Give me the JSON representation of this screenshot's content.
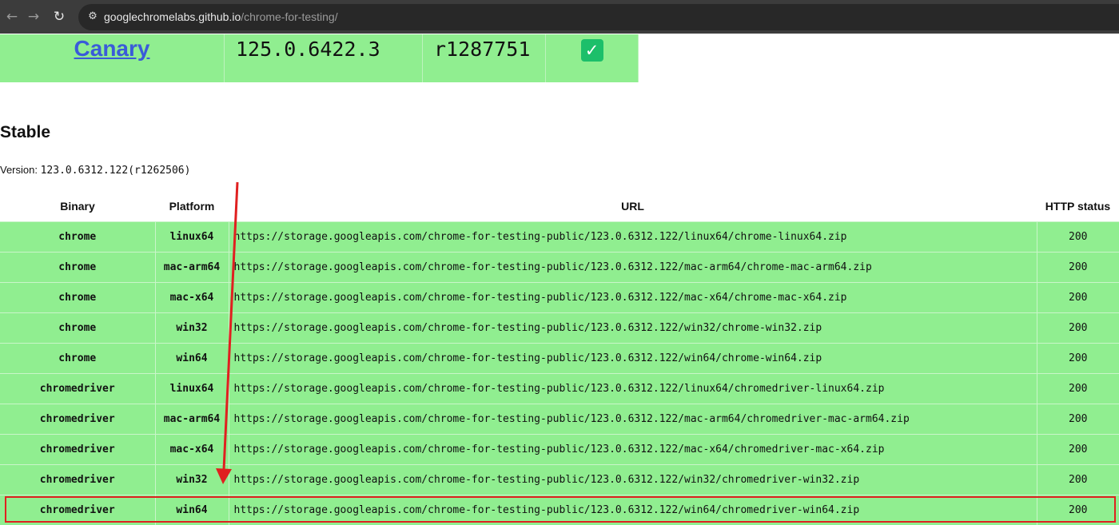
{
  "browser": {
    "url_host": "googlechromelabs.github.io",
    "url_path": "/chrome-for-testing/",
    "back_icon": "back-arrow-icon",
    "forward_icon": "forward-arrow-icon",
    "reload_icon": "reload-icon",
    "site_info_icon": "site-info-icon"
  },
  "canary": {
    "channel": "Canary",
    "version": "125.0.6422.3",
    "revision": "r1287751",
    "status_icon": "check-icon"
  },
  "stable": {
    "heading": "Stable",
    "version_label": "Version:",
    "version": "123.0.6312.122",
    "revision": "(r1262506)"
  },
  "table": {
    "headers": [
      "Binary",
      "Platform",
      "URL",
      "HTTP status"
    ],
    "rows": [
      {
        "binary": "chrome",
        "platform": "linux64",
        "url": "https://storage.googleapis.com/chrome-for-testing-public/123.0.6312.122/linux64/chrome-linux64.zip",
        "status": "200"
      },
      {
        "binary": "chrome",
        "platform": "mac-arm64",
        "url": "https://storage.googleapis.com/chrome-for-testing-public/123.0.6312.122/mac-arm64/chrome-mac-arm64.zip",
        "status": "200"
      },
      {
        "binary": "chrome",
        "platform": "mac-x64",
        "url": "https://storage.googleapis.com/chrome-for-testing-public/123.0.6312.122/mac-x64/chrome-mac-x64.zip",
        "status": "200"
      },
      {
        "binary": "chrome",
        "platform": "win32",
        "url": "https://storage.googleapis.com/chrome-for-testing-public/123.0.6312.122/win32/chrome-win32.zip",
        "status": "200"
      },
      {
        "binary": "chrome",
        "platform": "win64",
        "url": "https://storage.googleapis.com/chrome-for-testing-public/123.0.6312.122/win64/chrome-win64.zip",
        "status": "200"
      },
      {
        "binary": "chromedriver",
        "platform": "linux64",
        "url": "https://storage.googleapis.com/chrome-for-testing-public/123.0.6312.122/linux64/chromedriver-linux64.zip",
        "status": "200"
      },
      {
        "binary": "chromedriver",
        "platform": "mac-arm64",
        "url": "https://storage.googleapis.com/chrome-for-testing-public/123.0.6312.122/mac-arm64/chromedriver-mac-arm64.zip",
        "status": "200"
      },
      {
        "binary": "chromedriver",
        "platform": "mac-x64",
        "url": "https://storage.googleapis.com/chrome-for-testing-public/123.0.6312.122/mac-x64/chromedriver-mac-x64.zip",
        "status": "200"
      },
      {
        "binary": "chromedriver",
        "platform": "win32",
        "url": "https://storage.googleapis.com/chrome-for-testing-public/123.0.6312.122/win32/chromedriver-win32.zip",
        "status": "200"
      },
      {
        "binary": "chromedriver",
        "platform": "win64",
        "url": "https://storage.googleapis.com/chrome-for-testing-public/123.0.6312.122/win64/chromedriver-win64.zip",
        "status": "200"
      }
    ]
  },
  "annotation": {
    "highlight_color": "#e02020",
    "highlighted_row": 9
  },
  "colors": {
    "row_bg": "#90ee90",
    "link": "#3a5bd9"
  }
}
